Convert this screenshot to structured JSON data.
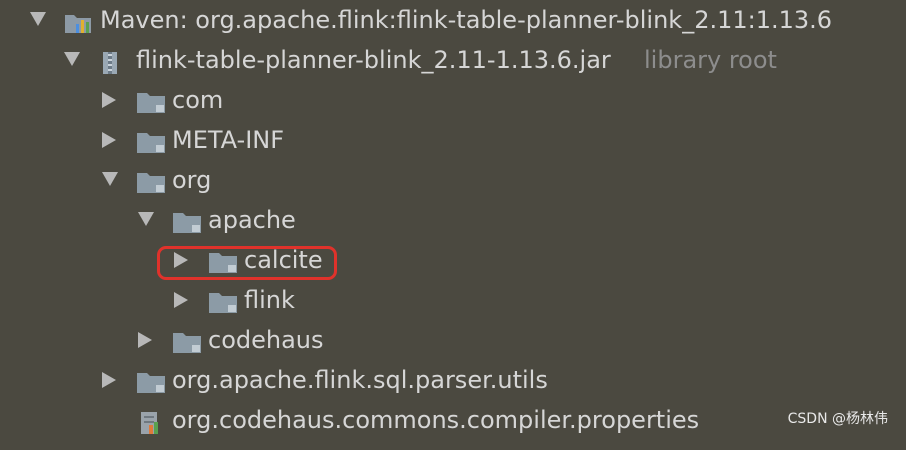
{
  "tree": {
    "root": {
      "label": "Maven: org.apache.flink:flink-table-planner-blink_2.11:1.13.6"
    },
    "jar": {
      "label": "flink-table-planner-blink_2.11-1.13.6.jar",
      "hint": "library root"
    },
    "items": [
      {
        "label": "com"
      },
      {
        "label": "META-INF"
      },
      {
        "label": "org"
      },
      {
        "label": "apache"
      },
      {
        "label": "calcite"
      },
      {
        "label": "flink"
      },
      {
        "label": "codehaus"
      },
      {
        "label": "org.apache.flink.sql.parser.utils"
      },
      {
        "label": "org.codehaus.commons.compiler.properties"
      }
    ]
  },
  "selection": {
    "highlighted_item": "calcite",
    "color": "#e0322b"
  },
  "watermark": {
    "text": "CSDN @杨林伟"
  }
}
